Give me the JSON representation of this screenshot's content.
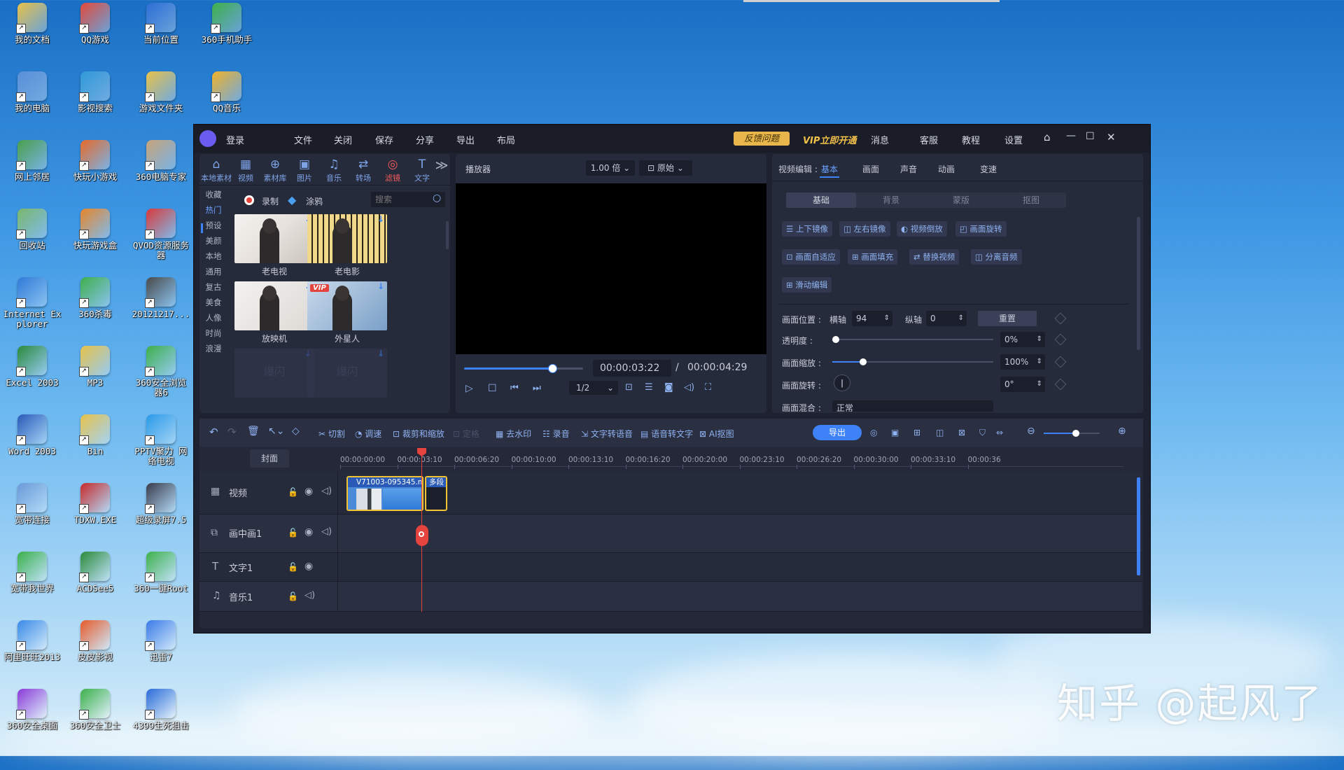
{
  "desktop": {
    "icons": [
      {
        "label": "我的文档",
        "col": 0,
        "row": 0,
        "color": "#e8c24a"
      },
      {
        "label": "QQ游戏",
        "col": 1,
        "row": 0,
        "color": "#e34a3a"
      },
      {
        "label": "当前位置",
        "col": 2,
        "row": 0,
        "color": "#2d6ed6"
      },
      {
        "label": "360手机助手",
        "col": 3,
        "row": 0,
        "color": "#3db04a"
      },
      {
        "label": "我的电脑",
        "col": 0,
        "row": 1,
        "color": "#5a8fd8"
      },
      {
        "label": "影视搜索",
        "col": 1,
        "row": 1,
        "color": "#2f9ad8"
      },
      {
        "label": "游戏文件夹",
        "col": 2,
        "row": 1,
        "color": "#e8c24a"
      },
      {
        "label": "QQ音乐",
        "col": 3,
        "row": 1,
        "color": "#f0b22a"
      },
      {
        "label": "网上邻居",
        "col": 0,
        "row": 2,
        "color": "#4aa04a"
      },
      {
        "label": "快玩小游戏",
        "col": 1,
        "row": 2,
        "color": "#e86a2a"
      },
      {
        "label": "360电脑专家",
        "col": 2,
        "row": 2,
        "color": "#c8a47a"
      },
      {
        "label": "回收站",
        "col": 0,
        "row": 3,
        "color": "#7ab86a"
      },
      {
        "label": "快玩游戏盒",
        "col": 1,
        "row": 3,
        "color": "#e8862a"
      },
      {
        "label": "QVOD资源服务器",
        "col": 2,
        "row": 3,
        "color": "#d83a3a"
      },
      {
        "label": "Internet Explorer",
        "col": 0,
        "row": 4,
        "color": "#2f7ad8"
      },
      {
        "label": "360杀毒",
        "col": 1,
        "row": 4,
        "color": "#3db04a"
      },
      {
        "label": "20121217...",
        "col": 2,
        "row": 4,
        "color": "#4a4a4a"
      },
      {
        "label": "Excel 2003",
        "col": 0,
        "row": 5,
        "color": "#2a8a3a"
      },
      {
        "label": "MP3",
        "col": 1,
        "row": 5,
        "color": "#e8c24a"
      },
      {
        "label": "360安全浏览器6",
        "col": 2,
        "row": 5,
        "color": "#3db04a"
      },
      {
        "label": "Word 2003",
        "col": 0,
        "row": 6,
        "color": "#2a5ab8"
      },
      {
        "label": "Bin",
        "col": 1,
        "row": 6,
        "color": "#e8c24a"
      },
      {
        "label": "PPTV聚力 网络电视",
        "col": 2,
        "row": 6,
        "color": "#2a9ae8"
      },
      {
        "label": "宽带连接",
        "col": 0,
        "row": 7,
        "color": "#6a9ad8"
      },
      {
        "label": "TDXW.EXE",
        "col": 1,
        "row": 7,
        "color": "#c82a2a"
      },
      {
        "label": "超级录屏7.5",
        "col": 2,
        "row": 7,
        "color": "#3a3a4a"
      },
      {
        "label": "宽带我世界",
        "col": 0,
        "row": 8,
        "color": "#3ab04a"
      },
      {
        "label": "ACDSee5",
        "col": 1,
        "row": 8,
        "color": "#2a8a3a"
      },
      {
        "label": "360一键Root",
        "col": 2,
        "row": 8,
        "color": "#3db04a"
      },
      {
        "label": "阿里旺旺2013",
        "col": 0,
        "row": 9,
        "color": "#3a8ae8"
      },
      {
        "label": "皮皮影视",
        "col": 1,
        "row": 9,
        "color": "#e85a2a"
      },
      {
        "label": "迅雷7",
        "col": 2,
        "row": 9,
        "color": "#3a7ae8"
      },
      {
        "label": "360安全桌面",
        "col": 0,
        "row": 10,
        "color": "#8a3ad8"
      },
      {
        "label": "360安全卫士",
        "col": 1,
        "row": 10,
        "color": "#3db04a"
      },
      {
        "label": "4399生死狙击",
        "col": 2,
        "row": 10,
        "color": "#2a6ad8"
      }
    ]
  },
  "watermark": "知乎 @起风了",
  "app": {
    "login": "登录",
    "menu": [
      "文件",
      "关闭",
      "保存",
      "分享",
      "导出",
      "布局"
    ],
    "feedback": "反馈问题",
    "vip": "VIP立即开通",
    "right_menu": [
      "消息",
      "客服",
      "教程",
      "设置"
    ],
    "media_tabs": [
      "本地素材",
      "视频",
      "素材库",
      "图片",
      "音乐",
      "转场",
      "滤镜",
      "文字"
    ],
    "media_tab_glyphs": [
      "⌂",
      "▦",
      "⊕",
      "▣",
      "♫",
      "⇄",
      "◎",
      "T"
    ],
    "categories": [
      "收藏",
      "热门",
      "预设",
      "美颜",
      "本地",
      "通用",
      "复古",
      "美食",
      "人像",
      "时尚",
      "浪漫"
    ],
    "record_label": "录制",
    "paint_label": "涂鸦",
    "search_placeholder": "搜索",
    "filters": [
      {
        "label": "老电视"
      },
      {
        "label": "老电影"
      },
      {
        "label": "放映机"
      },
      {
        "label": "外星人",
        "vip": "VIP"
      },
      {
        "label": "爆闪"
      },
      {
        "label": "爆闪"
      }
    ],
    "player": {
      "title": "播放器",
      "speed": "1.00 倍",
      "ratio": "原始",
      "current_time": "00:00:03:22",
      "separator": "/",
      "total_time": "00:00:04:29",
      "quality": "1/2",
      "progress": 0.74
    },
    "edit": {
      "label": "视频编辑 :",
      "tabs": [
        "基本",
        "画面",
        "声音",
        "动画",
        "变速"
      ],
      "subtabs": [
        "基础",
        "背景",
        "蒙版",
        "抠图"
      ],
      "buttons_row1": [
        "上下镜像",
        "左右镜像",
        "视频倒放",
        "画面旋转"
      ],
      "buttons_row2": [
        "画面自适应",
        "画面填充",
        "替换视频",
        "分离音频"
      ],
      "button_slide": "滑动编辑",
      "position_label": "画面位置 :",
      "x_label": "横轴",
      "x_value": "94",
      "y_label": "纵轴",
      "y_value": "0",
      "reset": "重置",
      "opacity_label": "透明度 :",
      "opacity_value": "0%",
      "opacity": 0,
      "scale_label": "画面缩放 :",
      "scale_value": "100%",
      "scale": 0.19,
      "rotate_label": "画面旋转 :",
      "rotate_value": "0°",
      "mix_label": "画面混合 :",
      "mix_value": "正常"
    },
    "toolbar": {
      "cut": "切割",
      "adjust": "调速",
      "crop": "裁剪和缩放",
      "freeze": "定格",
      "watermark": "去水印",
      "record": "录音",
      "tts": "文字转语音",
      "stt": "语音转文字",
      "ai": "AI抠图",
      "export": "导出",
      "zoom": 0.58
    },
    "timeline": {
      "cover": "封面",
      "ruler": [
        "00:00:00:00",
        "00:00:03:10",
        "00:00:06:20",
        "00:00:10:00",
        "00:00:13:10",
        "00:00:16:20",
        "00:00:20:00",
        "00:00:23:10",
        "00:00:26:20",
        "00:00:30:00",
        "00:00:33:10",
        "00:00:36"
      ],
      "tracks": [
        "视频",
        "画中画1",
        "文字1",
        "音乐1"
      ],
      "clip1": "V71003-095345.m",
      "clip2": "多段"
    }
  }
}
